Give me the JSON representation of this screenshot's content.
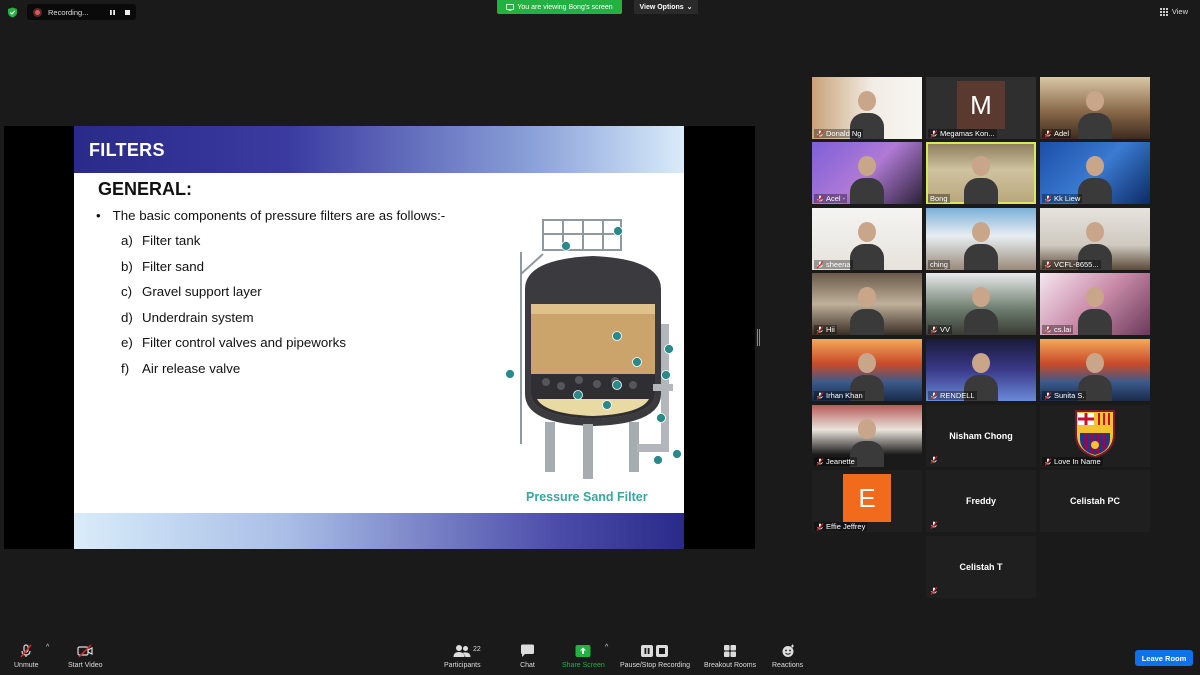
{
  "topbar": {
    "recording_label": "Recording...",
    "viewing_banner": "You are viewing Bong's screen",
    "view_options": "View Options",
    "view_label": "View"
  },
  "slide": {
    "title": "FILTERS",
    "heading": "GENERAL:",
    "bullet_mark": "•",
    "bullet": "The basic components of pressure filters are as follows:-",
    "items": [
      {
        "label": "a)",
        "text": "Filter tank"
      },
      {
        "label": "b)",
        "text": "Filter sand"
      },
      {
        "label": "c)",
        "text": "Gravel support layer"
      },
      {
        "label": "d)",
        "text": "Underdrain system"
      },
      {
        "label": "e)",
        "text": "Filter control valves and pipeworks"
      },
      {
        "label": "f)",
        "text": "Air release valve"
      }
    ],
    "caption": "Pressure Sand Filter"
  },
  "participants": [
    {
      "name": "Donald Ng",
      "kind": "video",
      "muted": true
    },
    {
      "name": "Megamas Kon...",
      "kind": "avatar",
      "avatar_letter": "M",
      "avatar_color": "#5a3a2e",
      "muted": true
    },
    {
      "name": "Adel",
      "kind": "video",
      "muted": true
    },
    {
      "name": "Acel -",
      "kind": "video",
      "muted": true
    },
    {
      "name": "Bong",
      "kind": "video",
      "muted": false,
      "active": true
    },
    {
      "name": "Kk Liew",
      "kind": "video",
      "muted": true
    },
    {
      "name": "sheena",
      "kind": "video",
      "muted": true
    },
    {
      "name": "ching",
      "kind": "video",
      "muted": false
    },
    {
      "name": "VCFL-8655...",
      "kind": "video",
      "muted": true
    },
    {
      "name": "Hii",
      "kind": "video",
      "muted": true
    },
    {
      "name": "VV",
      "kind": "video",
      "muted": true
    },
    {
      "name": "cs.lai",
      "kind": "video",
      "muted": true
    },
    {
      "name": "Irhan Khan",
      "kind": "video",
      "muted": true
    },
    {
      "name": "RENDELL",
      "kind": "video",
      "muted": true
    },
    {
      "name": "Sunita S.",
      "kind": "video",
      "muted": true
    },
    {
      "name": "Jeanette",
      "kind": "video",
      "muted": true
    },
    {
      "name": "Nisham Chong",
      "kind": "name",
      "muted": true
    },
    {
      "name": "Love In Name",
      "kind": "logo",
      "muted": true
    },
    {
      "name": "Effie Jeffrey",
      "kind": "avatar",
      "avatar_letter": "E",
      "avatar_color": "#f26a1b",
      "muted": true
    },
    {
      "name": "Freddy",
      "kind": "name",
      "muted": true
    },
    {
      "name": "Celistah PC",
      "kind": "name",
      "muted": false
    },
    {
      "name": "Celistah T",
      "kind": "name",
      "muted": true
    }
  ],
  "toolbar": {
    "unmute": "Unmute",
    "start_video": "Start Video",
    "participants": "Participants",
    "participants_count": "22",
    "chat": "Chat",
    "share_screen": "Share Screen",
    "pause_recording": "Pause/Stop Recording",
    "breakout_rooms": "Breakout Rooms",
    "reactions": "Reactions",
    "leave_room": "Leave Room"
  },
  "colors": {
    "background": "#1a1a1a",
    "share_green": "#23b242",
    "leave_blue": "#0e72ed",
    "active_speaker": "#d7e95a",
    "muted_red": "#e02828"
  }
}
